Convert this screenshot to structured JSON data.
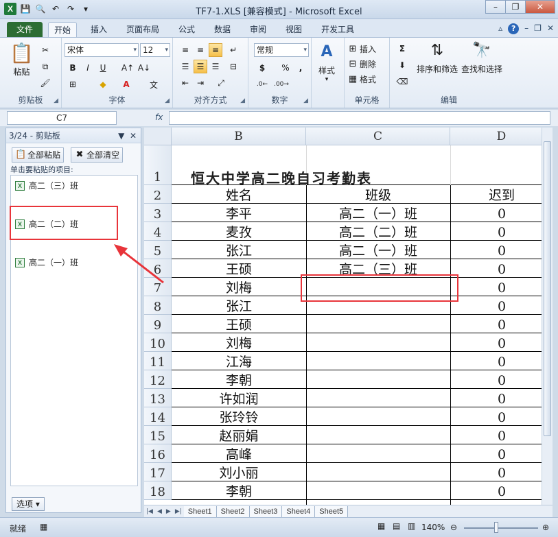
{
  "app": {
    "title": "TF7-1.XLS  [兼容模式] - Microsoft Excel",
    "qat_icons": [
      "excel-icon",
      "save-icon",
      "print-preview-icon",
      "undo-icon",
      "redo-icon"
    ]
  },
  "tabs": [
    "文件",
    "开始",
    "插入",
    "页面布局",
    "公式",
    "数据",
    "审阅",
    "视图",
    "开发工具"
  ],
  "ribbon": {
    "clipboard": {
      "paste": "粘贴",
      "label": "剪贴板"
    },
    "font": {
      "name": "宋体",
      "size": "12",
      "label": "字体",
      "bold": "B",
      "italic": "I",
      "underline": "U"
    },
    "alignment": {
      "label": "对齐方式"
    },
    "number": {
      "format": "常规",
      "label": "数字",
      "currency": "$",
      "percent": "%",
      "comma": ","
    },
    "styles": {
      "label": "样式"
    },
    "cells": {
      "insert": "插入",
      "delete": "删除",
      "format": "格式",
      "label": "单元格"
    },
    "editing": {
      "sort": "排序和筛选",
      "find": "查找和选择",
      "label": "编辑",
      "sum": "Σ"
    }
  },
  "formula_bar": {
    "name_box": "C7",
    "fx": "fx",
    "value": ""
  },
  "clipboard_pane": {
    "title": "3/24 - 剪贴板",
    "paste_all": "全部粘贴",
    "clear_all": "全部清空",
    "hint": "单击要粘贴的项目:",
    "items": [
      "高二（三）班",
      "高二（二）班",
      "高二（一）班"
    ],
    "options": "选项"
  },
  "sheet": {
    "columns": [
      "B",
      "C",
      "D"
    ],
    "rows": [
      "1",
      "2",
      "3",
      "4",
      "5",
      "6",
      "7",
      "8",
      "9",
      "10",
      "11",
      "12",
      "13",
      "14",
      "15",
      "16",
      "17",
      "18"
    ],
    "title": "恒大中学高二晚自习考勤表",
    "headers": [
      "姓名",
      "班级",
      "迟到"
    ],
    "data": [
      [
        "李平",
        "高二（一）班",
        "0"
      ],
      [
        "麦孜",
        "高二（二）班",
        "0"
      ],
      [
        "张江",
        "高二（一）班",
        "0"
      ],
      [
        "王硕",
        "高二（三）班",
        "0"
      ],
      [
        "刘梅",
        "",
        "0"
      ],
      [
        "张江",
        "",
        "0"
      ],
      [
        "王硕",
        "",
        "0"
      ],
      [
        "刘梅",
        "",
        "0"
      ],
      [
        "江海",
        "",
        "0"
      ],
      [
        "李朝",
        "",
        "0"
      ],
      [
        "许如润",
        "",
        "0"
      ],
      [
        "张玲铃",
        "",
        "0"
      ],
      [
        "赵丽娟",
        "",
        "0"
      ],
      [
        "高峰",
        "",
        "0"
      ],
      [
        "刘小丽",
        "",
        "0"
      ],
      [
        "李朝",
        "",
        "0"
      ]
    ],
    "sheet_tabs": [
      "Sheet1",
      "Sheet2",
      "Sheet3",
      "Sheet4",
      "Sheet5"
    ]
  },
  "status": {
    "ready": "就绪",
    "zoom": "140%"
  },
  "colors": {
    "annotation": "#e8343a",
    "file_tab": "#2c6d33"
  }
}
